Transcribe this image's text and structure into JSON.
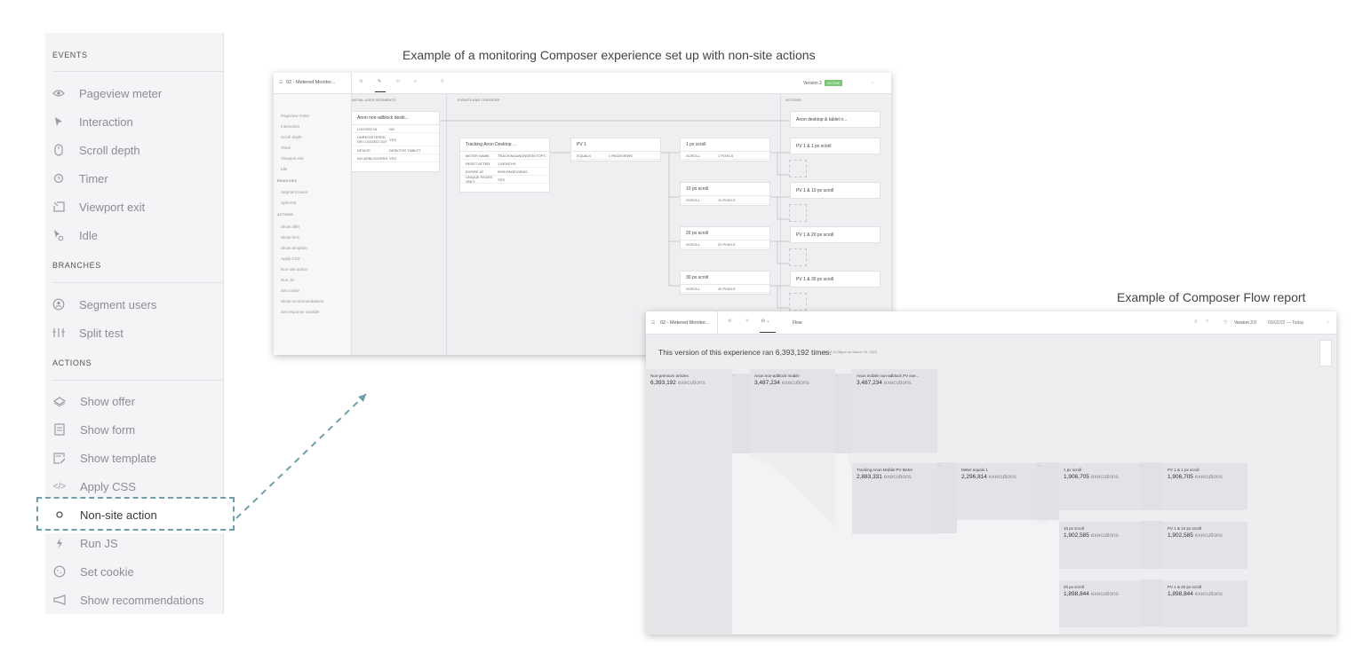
{
  "palette": {
    "events_heading": "EVENTS",
    "events": [
      {
        "label": "Pageview meter",
        "icon": "eye-icon"
      },
      {
        "label": "Interaction",
        "icon": "cursor-icon"
      },
      {
        "label": "Scroll depth",
        "icon": "mouse-icon"
      },
      {
        "label": "Timer",
        "icon": "clock-icon"
      },
      {
        "label": "Viewport exit",
        "icon": "exit-icon"
      },
      {
        "label": "Idle",
        "icon": "idle-cursor-icon"
      }
    ],
    "branches_heading": "BRANCHES",
    "branches": [
      {
        "label": "Segment users",
        "icon": "person-circle-icon"
      },
      {
        "label": "Split test",
        "icon": "split-icon"
      }
    ],
    "actions_heading": "ACTIONS",
    "actions": [
      {
        "label": "Show offer",
        "icon": "offer-icon"
      },
      {
        "label": "Show form",
        "icon": "form-icon"
      },
      {
        "label": "Show template",
        "icon": "template-icon"
      },
      {
        "label": "Apply CSS",
        "icon": "code-icon"
      },
      {
        "label": "Non-site action",
        "icon": "circle-icon"
      },
      {
        "label": "Run JS",
        "icon": "bolt-icon"
      },
      {
        "label": "Set cookie",
        "icon": "cookie-icon"
      },
      {
        "label": "Show recommendations",
        "icon": "megaphone-icon"
      }
    ]
  },
  "captions": {
    "composer": "Example of a monitoring Composer experience set up with non-site actions",
    "flow": "Example of Composer Flow report"
  },
  "composer": {
    "title": "02 - Metered Monitor...",
    "version": "Version 2",
    "version_badge": "ACTIVE",
    "headers": {
      "events": "EVENTS",
      "segments": "INITIAL USER SEGMENTS",
      "triggers": "EVENTS AND TRIGGERS",
      "actions": "ACTIONS"
    },
    "sidebar": {
      "events_heading": "EVENTS",
      "events": [
        "Pageview meter",
        "Interaction",
        "Scroll depth",
        "Timer",
        "Viewport exit",
        "Idle"
      ],
      "branches_heading": "BRANCHES",
      "branches": [
        "Segment users",
        "Split test"
      ],
      "actions_heading": "ACTIONS",
      "actions": [
        "Show offer",
        "Show form",
        "Show template",
        "Apply CSS",
        "Non-site action",
        "Run JS",
        "Set cookie",
        "Show recommendations",
        "Set response variable"
      ]
    },
    "segment_card": {
      "title": "Anon non-adblock deskt...",
      "rows": [
        [
          "LOGGED IN",
          "NO"
        ],
        [
          "UNREGISTERED OR LOGGED OUT",
          "YES"
        ],
        [
          "DEVICE",
          "DESKTOP, TABLET"
        ],
        [
          "NO ADBLOCKERS",
          "YES"
        ]
      ]
    },
    "tracking_card": {
      "title": "Tracking Anon Desktop ...",
      "rows": [
        [
          "METER NAME",
          "TRACKINGANONDESKTOPT..."
        ],
        [
          "RESET AFTER",
          "1 MONTHS"
        ],
        [
          "EXPIRE AT",
          "9999 PAGEVIEWS"
        ],
        [
          "UNIQUE PAGES ONLY",
          "YES"
        ]
      ]
    },
    "pv_card": {
      "title": "PV 1",
      "row": [
        "EQUALS",
        "1 PAGEVIEWS"
      ]
    },
    "scroll_cards": [
      {
        "title": "1 px scroll",
        "row": [
          "SCROLL",
          "1 PIXELS"
        ]
      },
      {
        "title": "10 px scroll",
        "row": [
          "SCROLL",
          "10 PIXELS"
        ]
      },
      {
        "title": "20 px scroll",
        "row": [
          "SCROLL",
          "20 PIXELS"
        ]
      },
      {
        "title": "30 px scroll",
        "row": [
          "SCROLL",
          "30 PIXELS"
        ]
      }
    ],
    "action_cards": [
      "Anon desktop & tablet n...",
      "PV 1 & 1 px scroll",
      "PV 1 & 10 px scroll",
      "PV 1 & 20 px scroll",
      "PV 1 & 30 px scroll"
    ]
  },
  "flow": {
    "title": "02 - Metered Monitor...",
    "tab": "Flow",
    "version": "Version 2.0",
    "date_range": "03/02/22 — Today",
    "summary": "This version of this experience ran 6,393,192 times.",
    "as_of": "As of 12:38pm on March 16, 2022",
    "nodes": [
      {
        "name": "Non-premium articles",
        "count": "6,393,192",
        "unit": "executions"
      },
      {
        "name": "Anon non-adblock mobile",
        "count": "3,487,234",
        "unit": "executions"
      },
      {
        "name": "Anon mobile non-adblock PV exe...",
        "count": "3,487,234",
        "unit": "executions"
      },
      {
        "name": "Tracking Anon Mobile PV Meter",
        "count": "2,883,331",
        "unit": "executions"
      },
      {
        "name": "Meter equals 1",
        "count": "2,296,814",
        "unit": "executions"
      },
      {
        "name": "1 px scroll",
        "count": "1,906,705",
        "unit": "executions"
      },
      {
        "name": "PV 1 & 1 px scroll",
        "count": "1,906,705",
        "unit": "executions"
      },
      {
        "name": "10 px scroll",
        "count": "1,902,585",
        "unit": "executions"
      },
      {
        "name": "PV 1 & 10 px scroll",
        "count": "1,902,585",
        "unit": "executions"
      },
      {
        "name": "20 px scroll",
        "count": "1,898,844",
        "unit": "executions"
      },
      {
        "name": "PV 1 & 20 px scroll",
        "count": "1,898,844",
        "unit": "executions"
      }
    ]
  }
}
